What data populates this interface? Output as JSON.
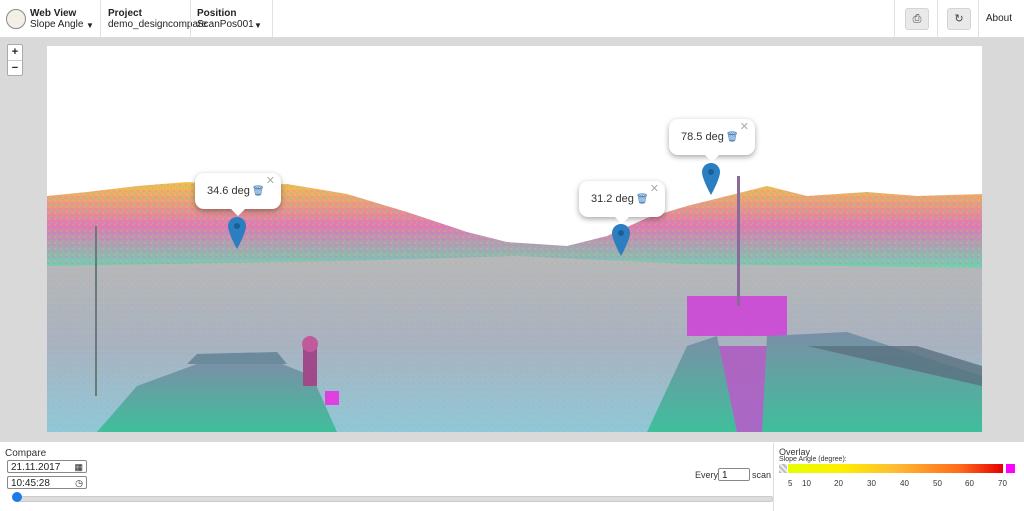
{
  "topbar": {
    "web_view": {
      "title": "Web View",
      "value": "Slope Angle"
    },
    "project": {
      "title": "Project",
      "value": "demo_designcompare"
    },
    "position": {
      "title": "Position",
      "value": "ScanPos001"
    },
    "print_icon": "printer-icon",
    "refresh_icon": "refresh-icon",
    "about": "About"
  },
  "zoom": {
    "in": "+",
    "out": "−"
  },
  "popups": [
    {
      "label": "34.6 deg"
    },
    {
      "label": "31.2 deg"
    },
    {
      "label": "78.5 deg"
    }
  ],
  "compare": {
    "label": "Compare",
    "date": "21.11.2017",
    "time": "10:45:28",
    "every_label": "Every",
    "every_value": "1",
    "scan_label": "scan",
    "slider_value": 0
  },
  "overlay": {
    "title": "Overlay",
    "subtitle": "Slope Angle (degree):",
    "ticks": [
      "5",
      "10",
      "20",
      "30",
      "40",
      "50",
      "60",
      "70"
    ],
    "colors": {
      "low": "#e6ff00",
      "mid": "#ffcc33",
      "high": "#ff3300",
      "outside": "#ff00ff"
    }
  }
}
